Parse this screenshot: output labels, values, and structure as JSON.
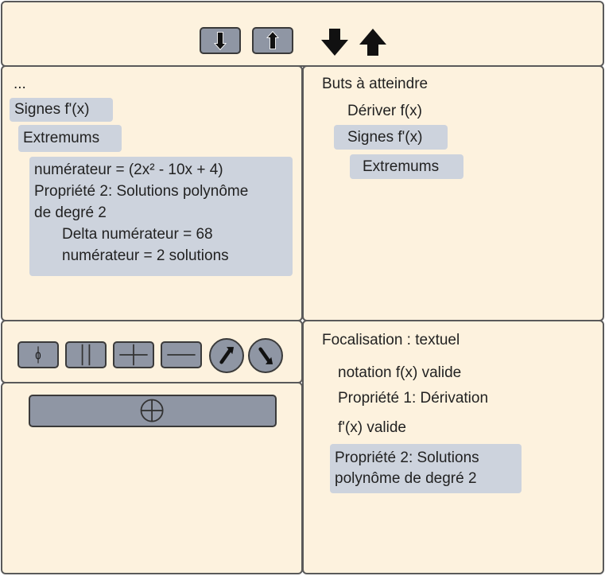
{
  "toolbar": {
    "down_button_icon": "down-arrow-in-box-icon",
    "up_button_icon": "up-arrow-in-box-icon",
    "down_arrow_icon": "thick-down-arrow-icon",
    "up_arrow_icon": "thick-up-arrow-icon"
  },
  "proof": {
    "ellipsis": "...",
    "step1": "Signes f'(x)",
    "step2": "Extremums",
    "block": {
      "line1": "numérateur = (2x² - 10x + 4)",
      "line2": "Propriété 2: Solutions polynôme",
      "line3": "de degré 2",
      "line4": "Delta numérateur = 68",
      "line5": "numérateur = 2 solutions"
    }
  },
  "goals": {
    "title": "Buts à atteindre",
    "items": [
      "Dériver f(x)",
      "Signes f'(x)",
      "Extremums"
    ]
  },
  "tools": {
    "zero_label": "0",
    "icons": [
      "zero-icon",
      "split-vertical-icon",
      "plus-icon",
      "minus-icon",
      "arrow-up-right-icon",
      "arrow-down-right-icon"
    ]
  },
  "work": {
    "add_icon": "circle-plus-icon"
  },
  "focus": {
    "title": "Focalisation : textuel",
    "items": [
      "notation f(x) valide",
      "Propriété 1: Dérivation",
      "f'(x) valide"
    ],
    "highlight_line1": "Propriété 2: Solutions",
    "highlight_line2": "polynôme de degré 2"
  },
  "colors": {
    "panel_bg": "#fdf2de",
    "highlight_bg": "#cdd3dd",
    "button_bg": "#8f96a4",
    "border": "#5a5a5a"
  }
}
